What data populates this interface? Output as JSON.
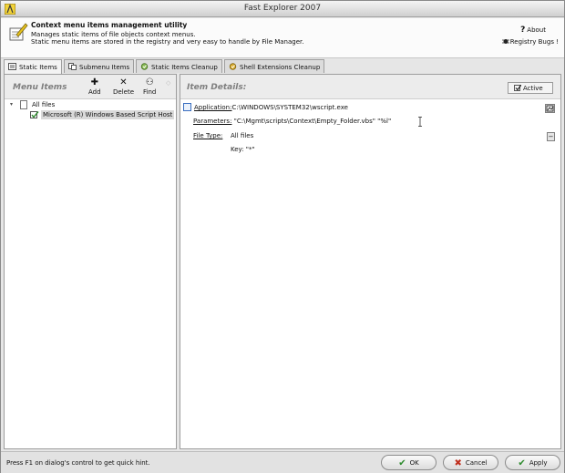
{
  "window": {
    "title": "Fast Explorer 2007"
  },
  "header": {
    "title": "Context menu items management utility",
    "line1": "Manages static items of file objects context menus.",
    "line2": "Static menu items are stored in the registry and very easy to handle by File Manager.",
    "about_label": "About",
    "registry_bugs_label": "Registry Bugs !"
  },
  "tabs": [
    {
      "label": "Static Items",
      "icon": "static-items-icon",
      "active": true
    },
    {
      "label": "Submenu Items",
      "icon": "submenu-items-icon",
      "active": false
    },
    {
      "label": "Static Items Cleanup",
      "icon": "cleanup-icon",
      "active": false
    },
    {
      "label": "Shell Extensions Cleanup",
      "icon": "shell-extensions-icon",
      "active": false
    }
  ],
  "left_panel": {
    "title": "Menu Items",
    "toolbar": {
      "add": "Add",
      "delete": "Delete",
      "find": "Find"
    },
    "tree": [
      {
        "label": "All files",
        "expanded": true
      },
      {
        "label": "Microsoft (R) Windows Based Script Host",
        "selected": true,
        "checked": true
      }
    ]
  },
  "right_panel": {
    "title": "Item Details:",
    "active_label": "Active",
    "active_checked": true,
    "application_label": "Application:",
    "application_value": "C:\\WINDOWS\\SYSTEM32\\wscript.exe",
    "parameters_label": "Parameters:",
    "parameters_value": "\"C:\\Mgmt\\scripts\\Context\\Empty_Folder.vbs\" \"%l\"",
    "file_type_label": "File Type:",
    "file_type_value": "All files",
    "key_label": "Key:",
    "key_value": "\"*\""
  },
  "status_bar": {
    "hint": "Press F1 on dialog's control to get quick hint.",
    "ok": "OK",
    "cancel": "Cancel",
    "apply": "Apply"
  },
  "colors": {
    "ok_check": "#2e8b2e",
    "cancel_x": "#c0301f",
    "apply_check": "#2e8b2e"
  }
}
